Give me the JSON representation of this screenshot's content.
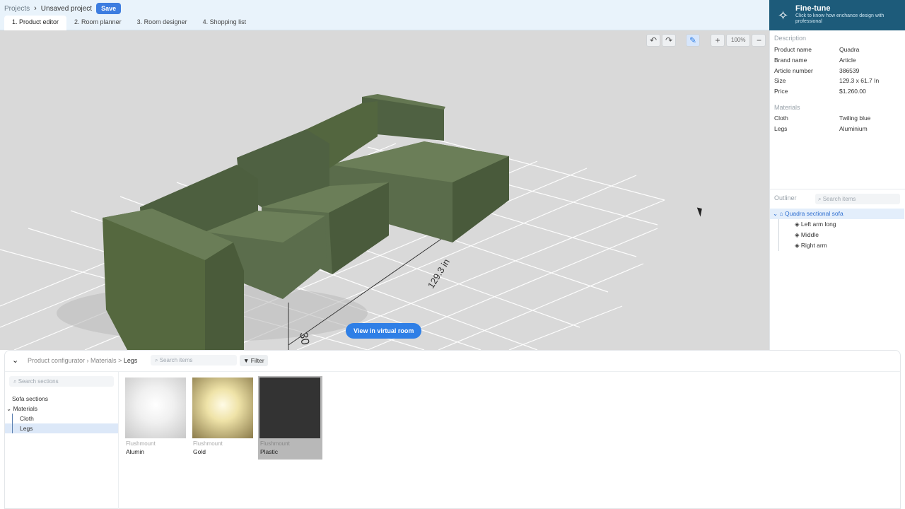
{
  "header": {
    "breadcrumb_projects": "Projects",
    "breadcrumb_sep": "›",
    "project_name": "Unsaved project",
    "save_label": "Save",
    "tabs": [
      {
        "label": "1. Product editor"
      },
      {
        "label": "2. Room planner"
      },
      {
        "label": "3. Room designer"
      },
      {
        "label": "4. Shopping list"
      }
    ]
  },
  "finetune": {
    "title": "Fine-tune",
    "subtitle": "Click to know how enchance design with professional"
  },
  "viewport": {
    "zoom": "100%",
    "dimension_label_length": "129.3 in",
    "dimension_label_depth": "30",
    "vr_button_label": "View in virtual room",
    "accent_color": "#2f7fe6"
  },
  "description": {
    "title": "Description",
    "fields": [
      {
        "k": "Product name",
        "v": "Quadra"
      },
      {
        "k": "Brand name",
        "v": "Article"
      },
      {
        "k": "Article number",
        "v": "386539"
      },
      {
        "k": "Size",
        "v": "129.3 x 61.7 In"
      },
      {
        "k": "Price",
        "v": "$1.260.00"
      }
    ]
  },
  "materials_info": {
    "title": "Materials",
    "fields": [
      {
        "k": "Cloth",
        "v": "Twiling blue"
      },
      {
        "k": "Legs",
        "v": "Aluminium"
      }
    ]
  },
  "outliner": {
    "title": "Outliner",
    "search_placeholder": "Search items",
    "root": "Quadra sectional sofa",
    "children": [
      "Left arm long",
      "Middle",
      "Right arm"
    ]
  },
  "configurator": {
    "crumb_root": "Product configurator",
    "crumb_mid": "Materials",
    "crumb_cur": "Legs",
    "search_placeholder": "Search items",
    "filter_label": "Filter",
    "sections_search_placeholder": "Search sections",
    "sections": [
      {
        "label": "Sofa sections"
      },
      {
        "label": "Materials"
      },
      {
        "label": "Cloth"
      },
      {
        "label": "Legs"
      }
    ],
    "materials": [
      {
        "category": "Flushmount",
        "name": "Alumin",
        "color": "#f2f2f2"
      },
      {
        "category": "Flushmount",
        "name": "Gold",
        "color": "#d9c98a"
      },
      {
        "category": "Flushmount",
        "name": "Plastic",
        "color": "#333333"
      }
    ]
  }
}
